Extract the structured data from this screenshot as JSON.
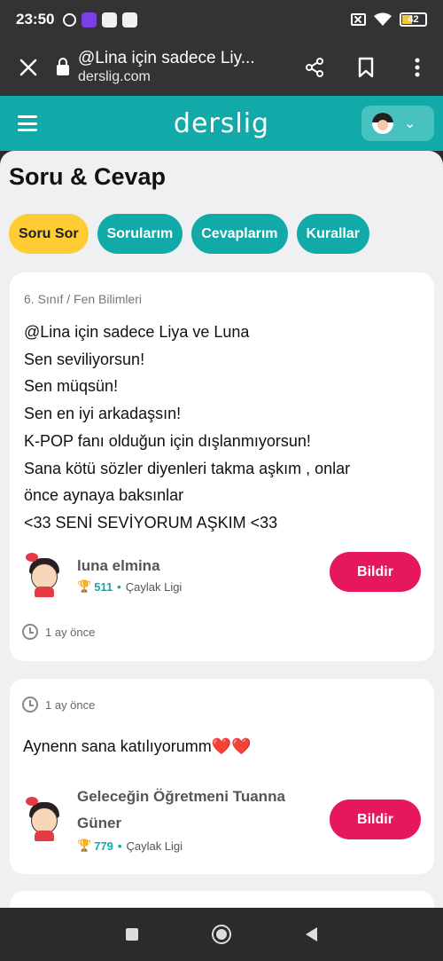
{
  "status_bar": {
    "time": "23:50",
    "battery": "42"
  },
  "browser": {
    "page_title": "@Lina için sadece Liy...",
    "domain": "derslig.com",
    "icons": [
      "close-icon",
      "lock-icon",
      "share-icon",
      "bookmark-icon",
      "more-vert-icon"
    ]
  },
  "site": {
    "logo": "derslig",
    "accent_color": "#12a9a9"
  },
  "page": {
    "title": "Soru & Cevap",
    "tabs": [
      {
        "label": "Soru Sor",
        "active": true
      },
      {
        "label": "Sorularım",
        "active": false
      },
      {
        "label": "Cevaplarım",
        "active": false
      },
      {
        "label": "Kurallar",
        "active": false
      }
    ]
  },
  "question": {
    "subject": "6. Sınıf / Fen Bilimleri",
    "lines": [
      "@Lina için sadece Liya ve Luna",
      "Sen seviliyorsun!",
      "Sen müqsün!",
      "Sen en iyi arkadaşsın!",
      "K-POP fanı olduğun için dışlanmıyorsun!",
      "Sana kötü sözler diyenleri takma aşkım , onlar",
      "önce aynaya baksınlar",
      "<33 SENİ SEVİYORUM AŞKIM <33"
    ],
    "author": {
      "name": "luna elmina",
      "points": "511",
      "league": "Çaylak Ligi"
    },
    "report_label": "Bildir",
    "time": "1 ay önce"
  },
  "answer": {
    "time": "1 ay önce",
    "text": "Aynenn sana katılıyorumm",
    "emoji": "❤️❤️",
    "author": {
      "name_line1": "Geleceğin Öğretmeni Tuanna",
      "name_line2": "Güner",
      "points": "779",
      "league": "Çaylak Ligi"
    },
    "report_label": "Bildir"
  }
}
